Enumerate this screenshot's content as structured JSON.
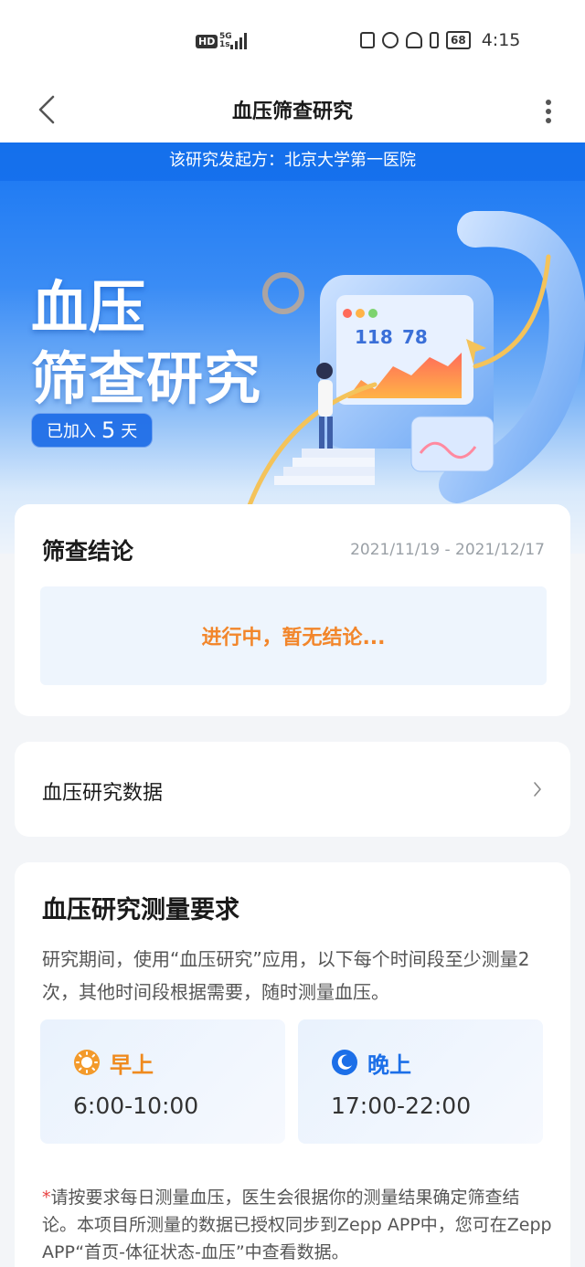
{
  "status_bar": {
    "hd": "HD",
    "network": "5G",
    "network_sub": "1s",
    "battery": "68",
    "time": "4:15"
  },
  "nav": {
    "title": "血压筛查研究"
  },
  "hero": {
    "sponsor": "该研究发起方：北京大学第一医院",
    "title_line1": "血压",
    "title_line2": "筛查研究",
    "joined_prefix": "已加入",
    "joined_days": "5",
    "joined_suffix": "天",
    "readout_sys": "118",
    "readout_dia": "78"
  },
  "conclusion": {
    "title": "筛查结论",
    "date_range": "2021/11/19 - 2021/12/17",
    "status": "进行中，暂无结论..."
  },
  "data_entry": {
    "label": "血压研究数据"
  },
  "requirements": {
    "title": "血压研究测量要求",
    "description": "研究期间，使用“血压研究”应用，以下每个时间段至少测量2次，其他时间段根据需要，随时测量血压。",
    "slots": [
      {
        "label": "早上",
        "time": "6:00-10:00",
        "icon": "sun-icon"
      },
      {
        "label": "晚上",
        "time": "17:00-22:00",
        "icon": "moon-icon"
      }
    ],
    "note_mark": "*",
    "note": "请按要求每日测量血压，医生会很据你的测量结果确定筛查结论。本项目所测量的数据已授权同步到Zepp APP中，您可在Zepp APP“首页-体征状态-血压”中查看数据。"
  },
  "colors": {
    "accent_blue": "#1876f2",
    "status_orange": "#f2862b",
    "morning_orange": "#ef8a1e",
    "evening_blue": "#1c6fe8",
    "note_star": "#e84343"
  }
}
